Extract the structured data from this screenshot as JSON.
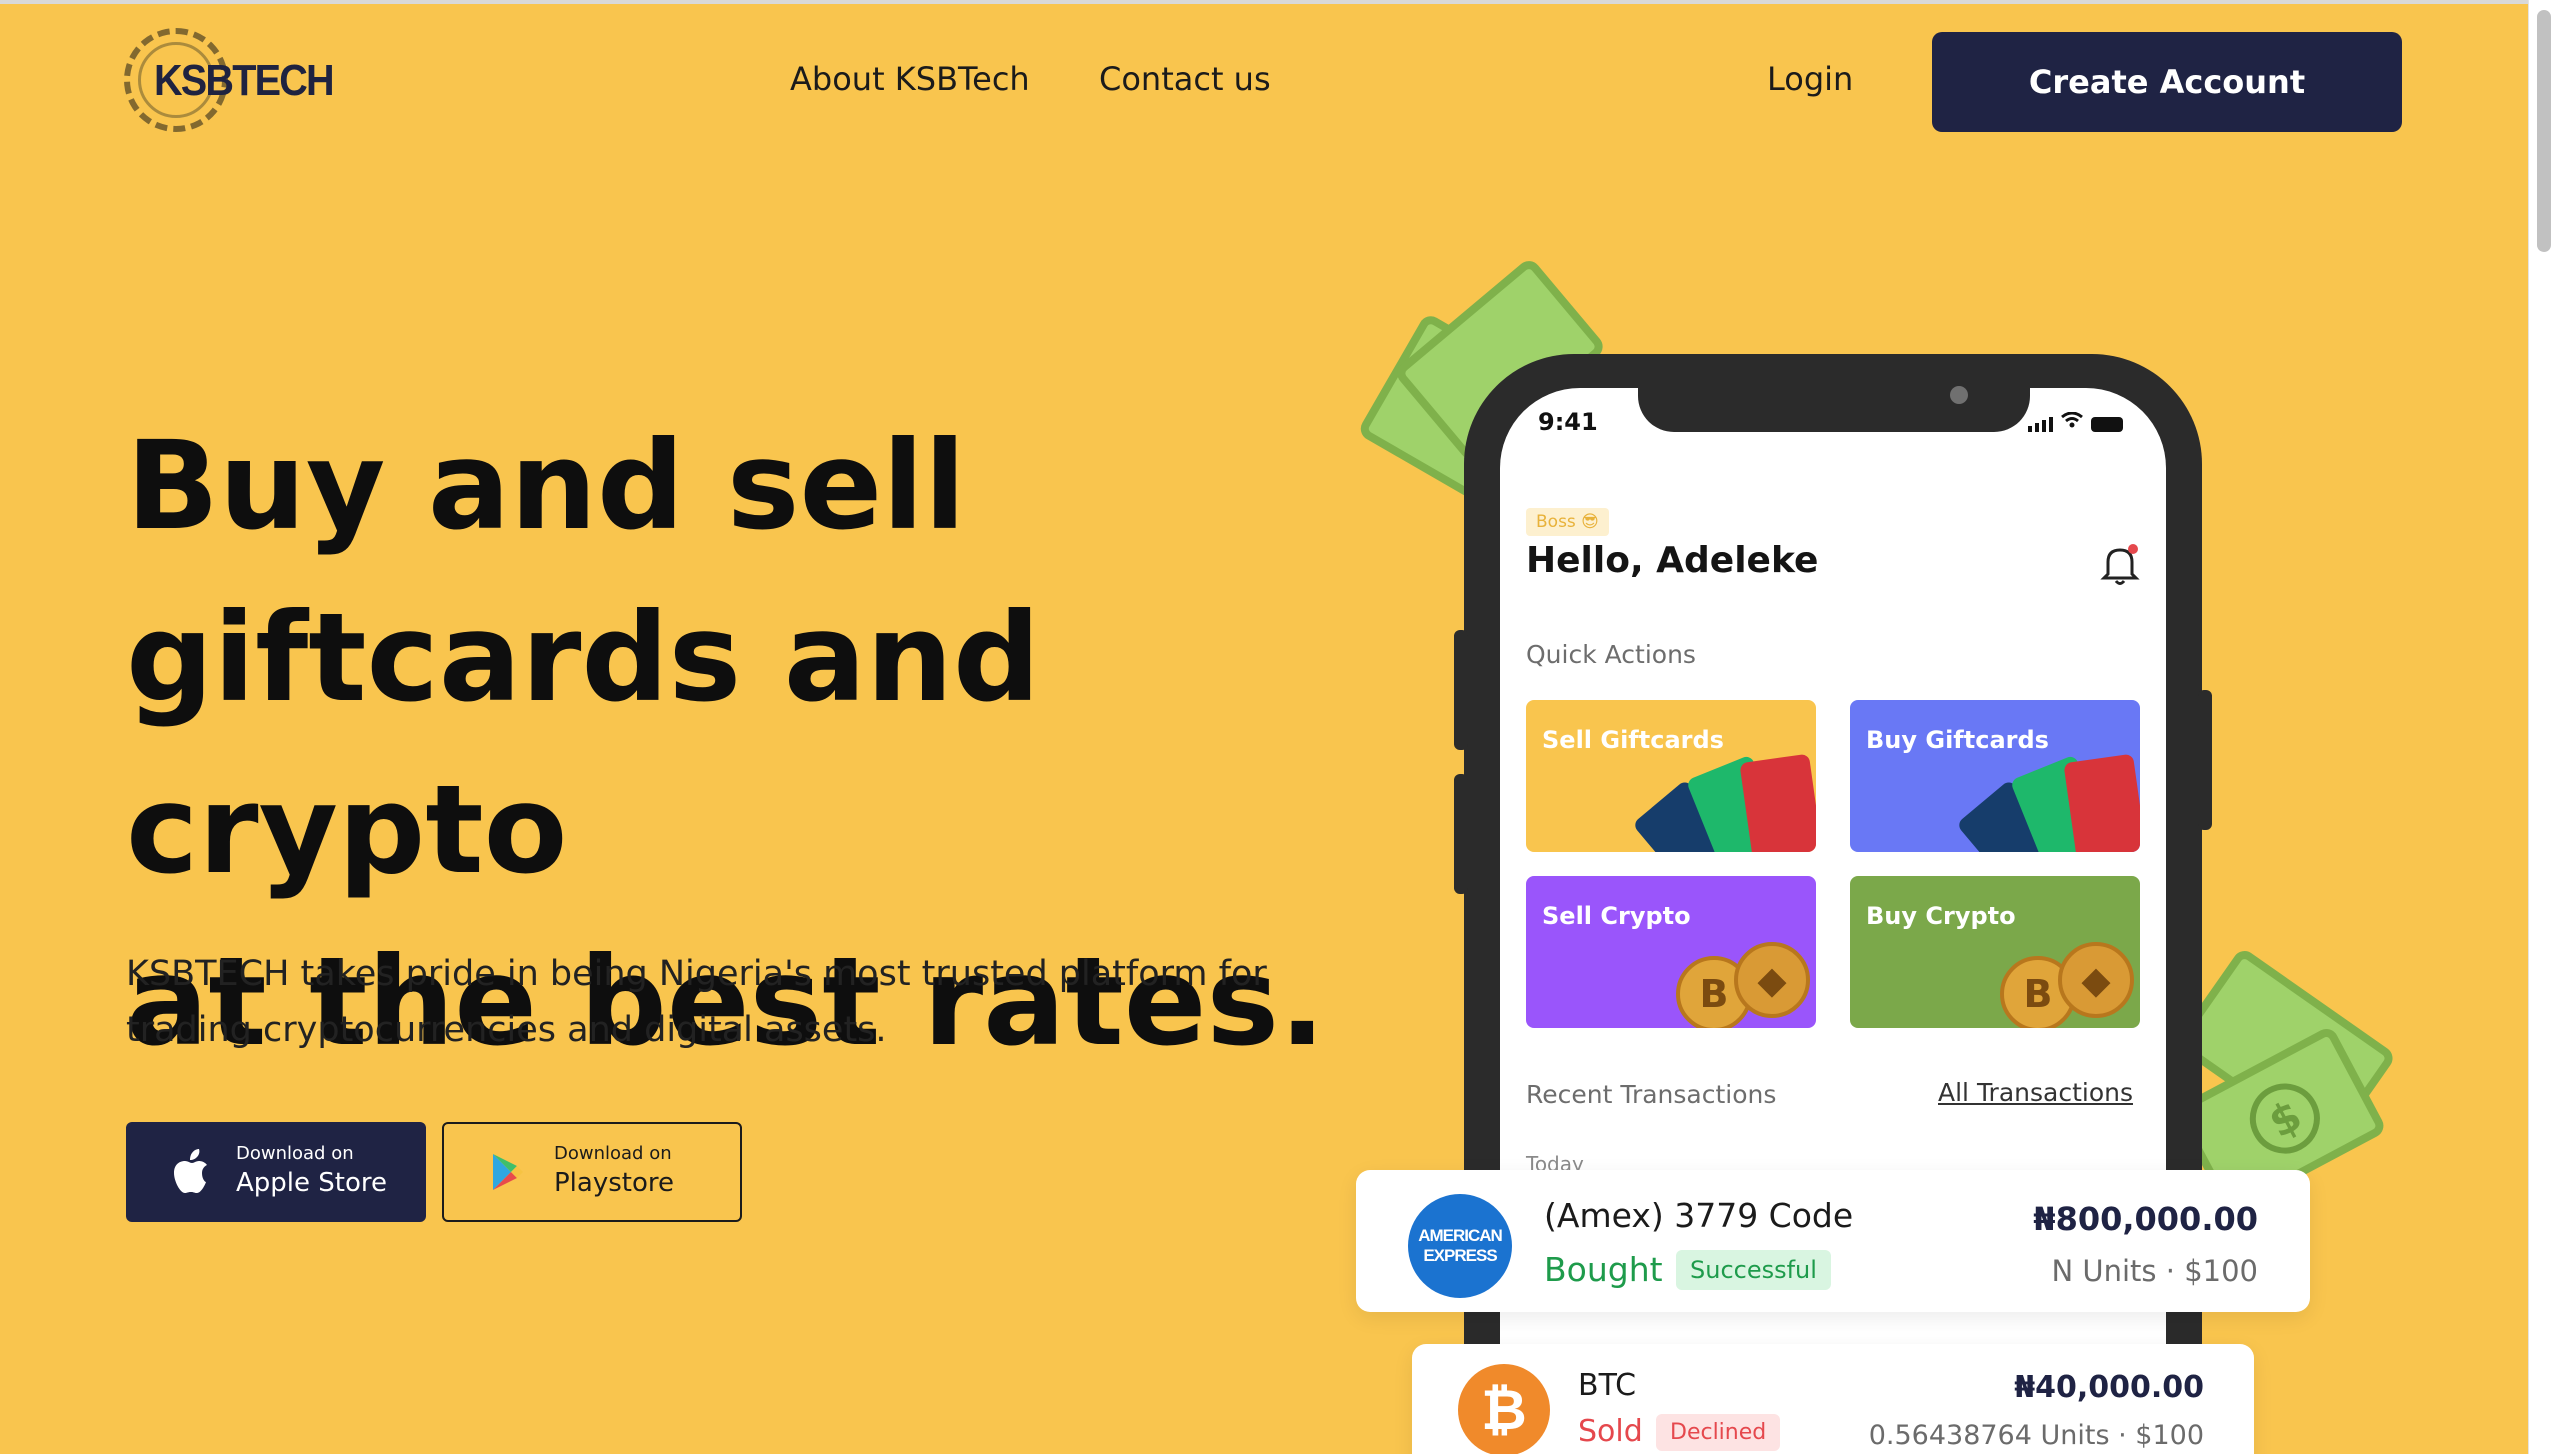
{
  "header": {
    "logo_text": "KSBTECH",
    "nav": [
      "About KSBTech",
      "Contact us"
    ],
    "login": "Login",
    "create_account": "Create Account"
  },
  "hero": {
    "title_lines": [
      "Buy and sell",
      "giftcards and crypto",
      "at the best rates."
    ],
    "subtitle_lines": [
      "KSBTECH takes pride in being Nigeria's most trusted platform for",
      "trading cryptocurrencies and digital assets."
    ],
    "apple": {
      "small": "Download on",
      "big": "Apple Store",
      "icon": "apple-icon"
    },
    "play": {
      "small": "Download on",
      "big": "Playstore",
      "icon": "play-store-icon"
    }
  },
  "phone": {
    "time": "9:41",
    "badge": "Boss 😎",
    "greeting": "Hello, Adeleke",
    "quick_actions_title": "Quick Actions",
    "actions": [
      "Sell Giftcards",
      "Buy Giftcards",
      "Sell Crypto",
      "Buy Crypto"
    ],
    "recent_title": "Recent Transactions",
    "all_transactions": "All Transactions",
    "today": "Today"
  },
  "transactions": [
    {
      "logo_text": "AMERICAN EXPRESS",
      "name": "(Amex) 3779 Code",
      "action": "Bought",
      "status": "Successful",
      "amount": "₦800,000.00",
      "units": "N Units",
      "value": "$100"
    },
    {
      "logo_text": "₿",
      "name": "BTC",
      "action": "Sold",
      "status": "Declined",
      "amount": "₦40,000.00",
      "units": "0.56438764 Units",
      "value": "$100"
    }
  ],
  "colors": {
    "background": "#f9c54e",
    "primary": "#1f2344",
    "success": "#1e9b4b",
    "declined": "#e5484d"
  }
}
